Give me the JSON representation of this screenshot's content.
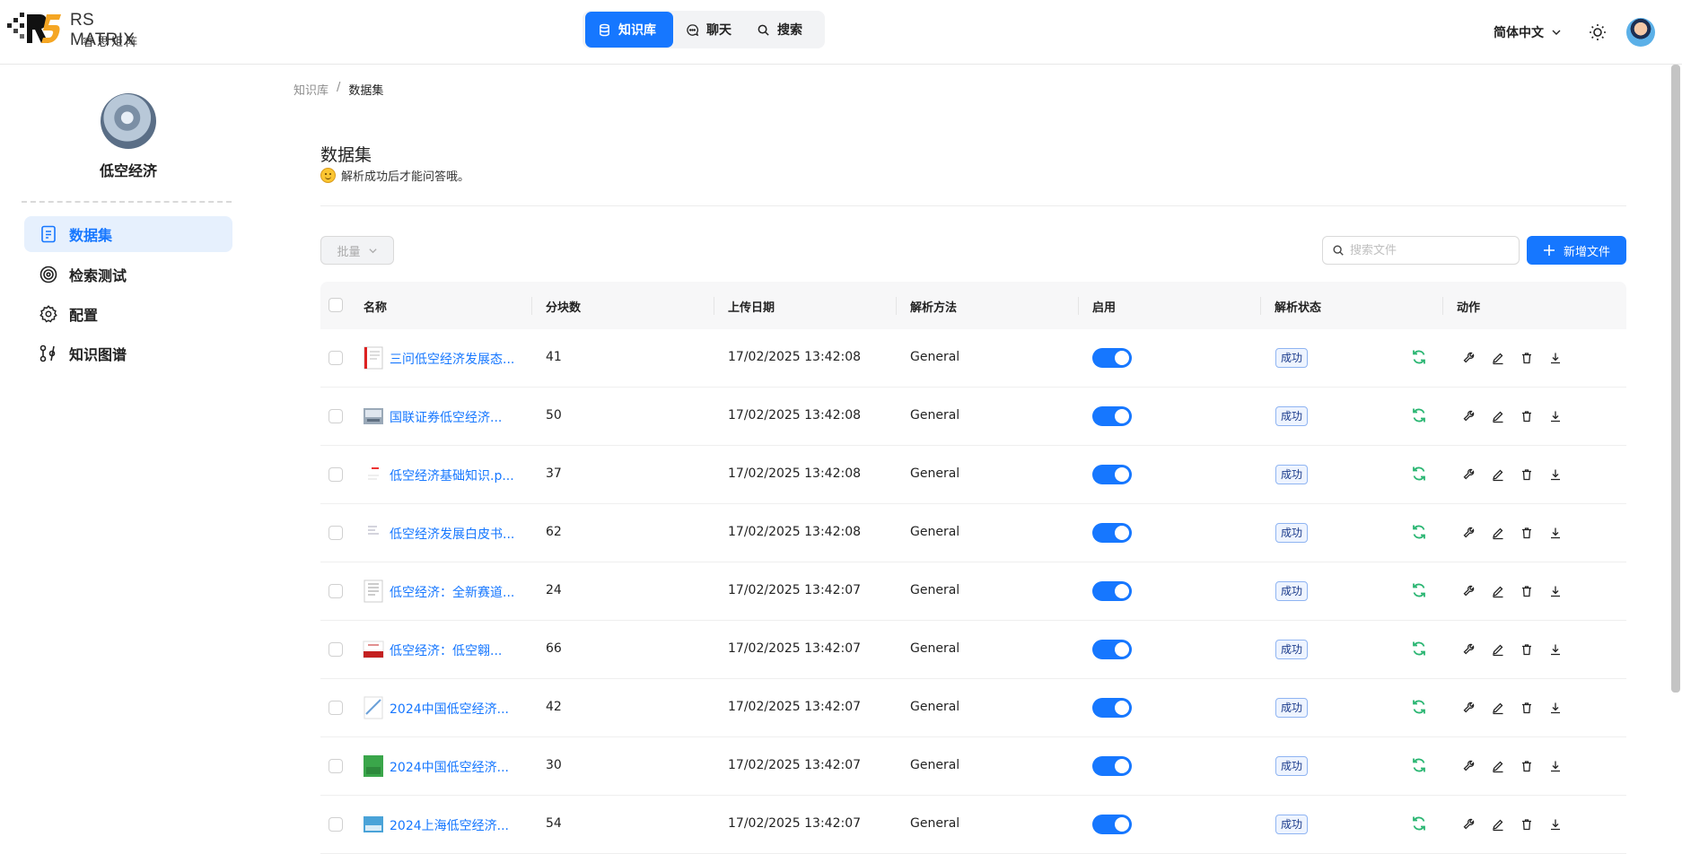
{
  "app": {
    "logo_title": "RS MATRIX",
    "logo_subtitle": "睿思矩阵"
  },
  "topnav": {
    "tabs": [
      {
        "label": "知识库",
        "icon": "database-icon",
        "active": true
      },
      {
        "label": "聊天",
        "icon": "chat-icon",
        "active": false
      },
      {
        "label": "搜索",
        "icon": "search-icon",
        "active": false
      }
    ]
  },
  "header": {
    "language": "简体中文"
  },
  "sidebar": {
    "kb_name": "低空经济",
    "items": [
      {
        "label": "数据集",
        "icon": "document-icon",
        "active": true
      },
      {
        "label": "检索测试",
        "icon": "target-icon",
        "active": false
      },
      {
        "label": "配置",
        "icon": "gear-icon",
        "active": false
      },
      {
        "label": "知识图谱",
        "icon": "graph-icon",
        "active": false
      }
    ]
  },
  "breadcrumb": {
    "root": "知识库",
    "separator": "/",
    "current": "数据集"
  },
  "page": {
    "title": "数据集",
    "description": "解析成功后才能问答哦。"
  },
  "toolbar": {
    "batch_label": "批量",
    "search_placeholder": "搜索文件",
    "add_label": "新增文件"
  },
  "table": {
    "columns": [
      "名称",
      "分块数",
      "上传日期",
      "解析方法",
      "启用",
      "解析状态",
      "动作"
    ],
    "rows": [
      {
        "name": "三问低空经济发展态...",
        "chunks": "41",
        "date": "17/02/2025 13:42:08",
        "method": "General",
        "enabled": true,
        "status": "成功"
      },
      {
        "name": "国联证券低空经济...",
        "chunks": "50",
        "date": "17/02/2025 13:42:08",
        "method": "General",
        "enabled": true,
        "status": "成功"
      },
      {
        "name": "低空经济基础知识.p...",
        "chunks": "37",
        "date": "17/02/2025 13:42:08",
        "method": "General",
        "enabled": true,
        "status": "成功"
      },
      {
        "name": "低空经济发展白皮书...",
        "chunks": "62",
        "date": "17/02/2025 13:42:08",
        "method": "General",
        "enabled": true,
        "status": "成功"
      },
      {
        "name": "低空经济：全新赛道...",
        "chunks": "24",
        "date": "17/02/2025 13:42:07",
        "method": "General",
        "enabled": true,
        "status": "成功"
      },
      {
        "name": "低空经济：低空翱...",
        "chunks": "66",
        "date": "17/02/2025 13:42:07",
        "method": "General",
        "enabled": true,
        "status": "成功"
      },
      {
        "name": "2024中国低空经济...",
        "chunks": "42",
        "date": "17/02/2025 13:42:07",
        "method": "General",
        "enabled": true,
        "status": "成功"
      },
      {
        "name": "2024中国低空经济...",
        "chunks": "30",
        "date": "17/02/2025 13:42:07",
        "method": "General",
        "enabled": true,
        "status": "成功"
      },
      {
        "name": "2024上海低空经济...",
        "chunks": "54",
        "date": "17/02/2025 13:42:07",
        "method": "General",
        "enabled": true,
        "status": "成功"
      }
    ]
  },
  "colors": {
    "accent": "#1677ff",
    "success_icon": "#2bb673"
  }
}
